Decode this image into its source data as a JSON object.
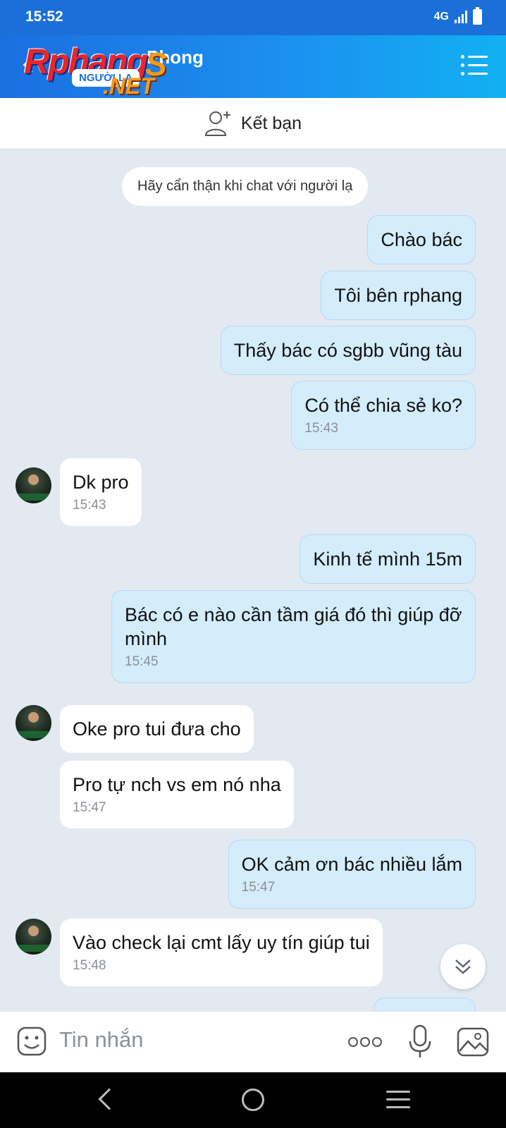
{
  "status_bar": {
    "time": "15:52",
    "network": "4G"
  },
  "header": {
    "name": "Phong",
    "logo_main": "Rphang",
    "logo_sub": "NGƯỜI LẠ",
    "logo_net": ".NET",
    "logo_s": "S"
  },
  "friend_bar": {
    "label": "Kết bạn"
  },
  "notice": "Hãy cẩn thận khi chat với người lạ",
  "messages": [
    {
      "side": "me",
      "text": "Chào bác",
      "time": ""
    },
    {
      "side": "me",
      "text": "Tôi bên rphang",
      "time": ""
    },
    {
      "side": "me",
      "text": "Thấy bác có sgbb vũng tàu",
      "time": ""
    },
    {
      "side": "me",
      "text": "Có thể chia sẻ ko?",
      "time": "15:43"
    },
    {
      "side": "other",
      "text": "Dk pro",
      "time": "15:43"
    },
    {
      "side": "me",
      "text": "Kinh tế mình 15m",
      "time": ""
    },
    {
      "side": "me",
      "text": "Bác có e nào cần tầm giá đó thì giúp đỡ mình",
      "time": "15:45"
    },
    {
      "side": "other",
      "text": "Oke pro tui đưa cho",
      "time": ""
    },
    {
      "side": "other",
      "text": "Pro tự nch vs em nó nha",
      "time": "15:47"
    },
    {
      "side": "me",
      "text": "OK cảm ơn bác nhiều lắm",
      "time": "15:47"
    },
    {
      "side": "other",
      "text": "Vào check lại cmt lấy uy tín giúp tui",
      "time": "15:48"
    }
  ],
  "input": {
    "placeholder": "Tin nhắn"
  },
  "icons": {
    "back": "back-icon",
    "menu": "menu-icon",
    "add_friend": "add-friend-icon",
    "sticker": "sticker-icon",
    "more": "more-icon",
    "mic": "mic-icon",
    "image": "image-icon",
    "scroll_down": "chevron-double-down-icon"
  },
  "colors": {
    "header": "#1b8ff0",
    "my_bubble": "#d4ecfc",
    "other_bubble": "#ffffff",
    "chat_bg": "#e2e9f1"
  }
}
